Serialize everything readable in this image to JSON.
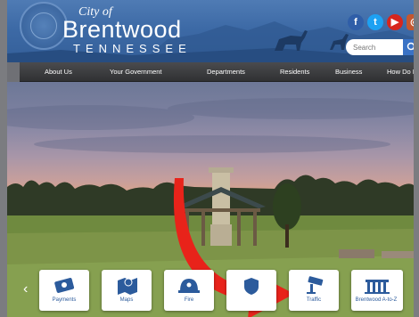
{
  "header": {
    "brand_prefix": "City of",
    "brand_name": "Brentwood",
    "brand_state": "TENNESSEE",
    "social": [
      {
        "icon": "facebook-icon",
        "glyph": "f"
      },
      {
        "icon": "twitter-icon",
        "glyph": "t"
      },
      {
        "icon": "youtube-icon",
        "glyph": "▶"
      },
      {
        "icon": "instagram-icon",
        "glyph": "◎"
      }
    ],
    "search": {
      "placeholder": "Search",
      "value": ""
    }
  },
  "nav": {
    "items": [
      {
        "label": "About Us"
      },
      {
        "label": "Your Government"
      },
      {
        "label": "Departments"
      },
      {
        "label": "Residents"
      },
      {
        "label": "Business"
      },
      {
        "label": "How Do I?"
      }
    ]
  },
  "quick_links": {
    "prev_glyph": "‹",
    "items": [
      {
        "label": "Payments",
        "icon": "payments-icon"
      },
      {
        "label": "Maps",
        "icon": "maps-icon"
      },
      {
        "label": "Fire",
        "icon": "fire-helmet-icon"
      },
      {
        "label": "",
        "icon": "police-icon"
      },
      {
        "label": "Traffic",
        "icon": "traffic-camera-icon"
      },
      {
        "label": "Brentwood A-to-Z",
        "icon": "a-to-z-icon"
      }
    ]
  },
  "colors": {
    "header_blue": "#3d6aa6",
    "nav_dark": "#303133",
    "quick_label_blue": "#2c5b9c",
    "annotation_arrow": "#e8231a"
  }
}
